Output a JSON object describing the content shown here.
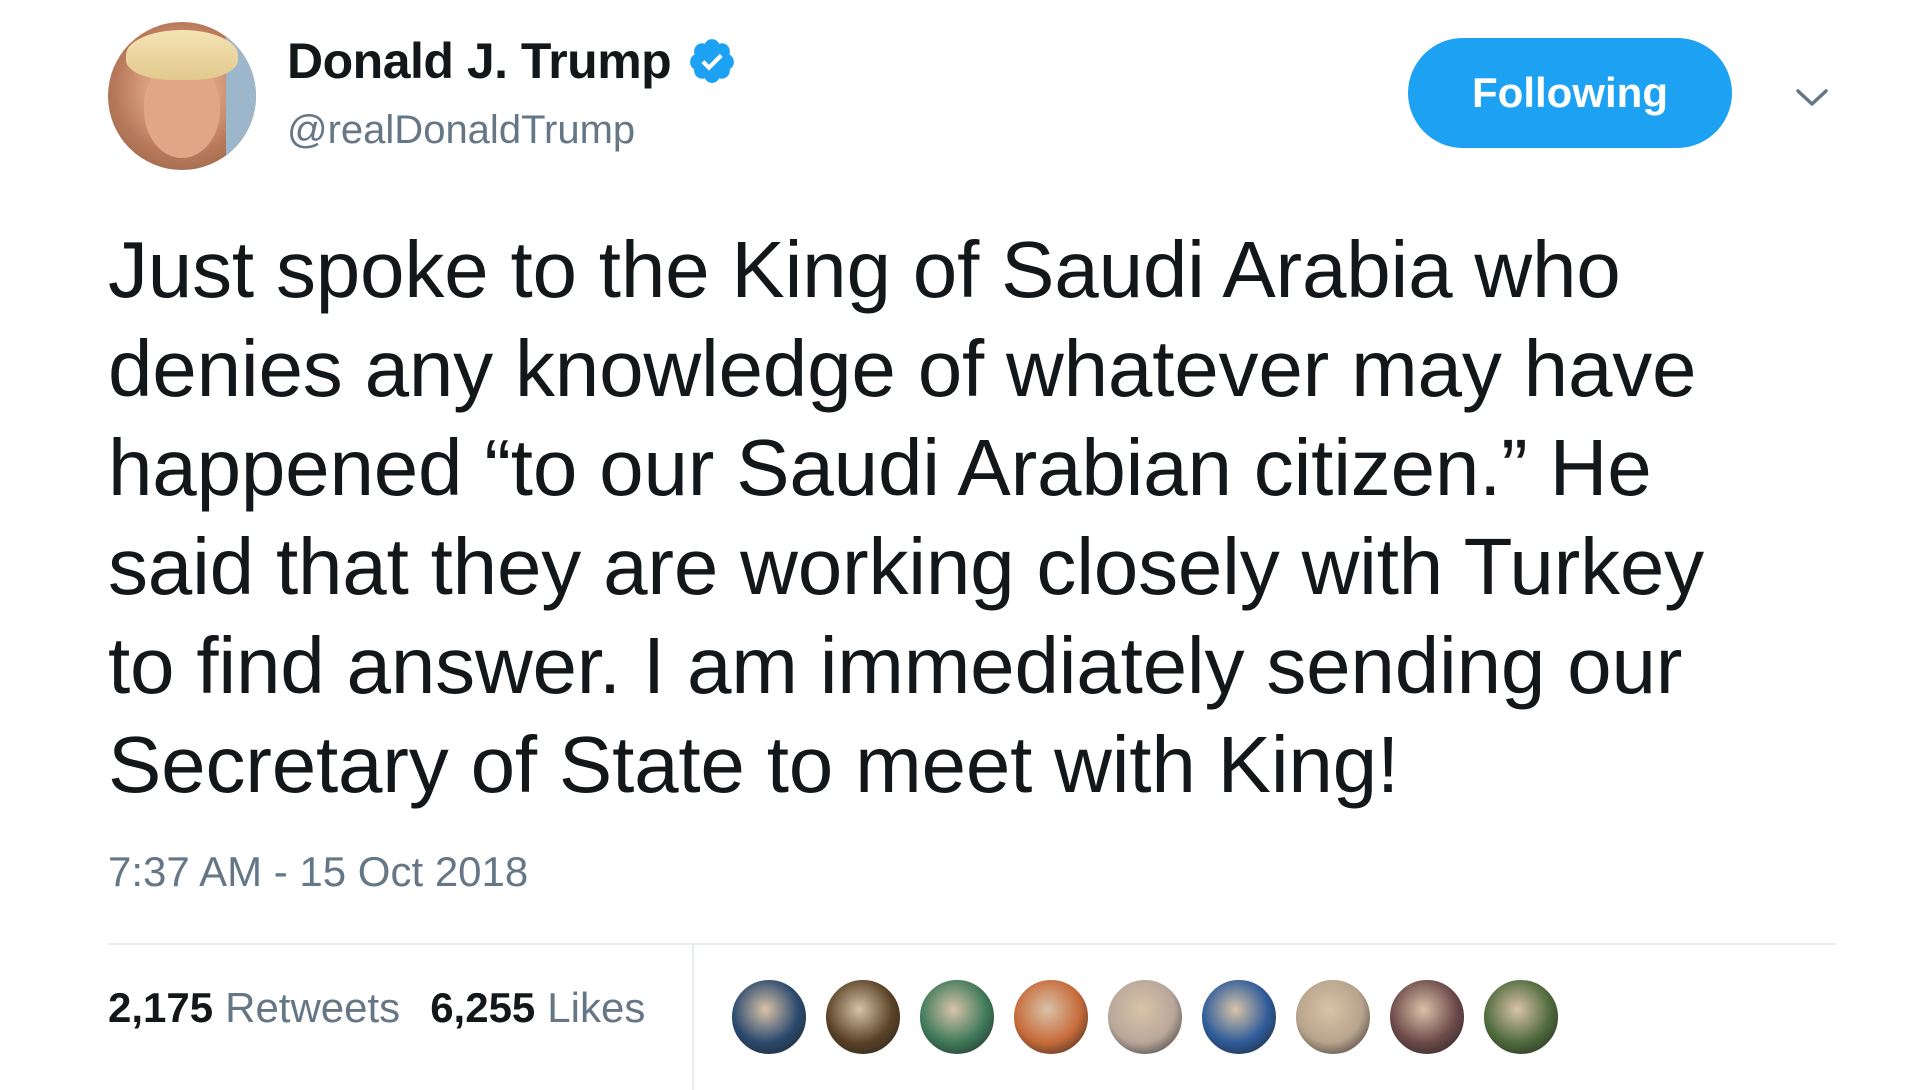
{
  "user": {
    "display_name": "Donald J. Trump",
    "handle": "@realDonaldTrump",
    "verified": true
  },
  "follow_button": {
    "label": "Following",
    "color": "#1da1f2"
  },
  "tweet": {
    "lines": [
      "Just spoke to the King of Saudi Arabia who",
      "denies any knowledge of whatever may have",
      "happened “to our Saudi Arabian citizen.” He",
      "said that they are working closely with Turkey",
      "to find answer. I am immediately sending our",
      "Secretary of State to meet with King!"
    ],
    "timestamp": "7:37 AM - 15 Oct 2018"
  },
  "stats": {
    "retweets_count": "2,175",
    "retweets_label": "Retweets",
    "likes_count": "6,255",
    "likes_label": "Likes"
  },
  "likers": [
    {
      "icon": "avatar",
      "color": "#2b4a6e"
    },
    {
      "icon": "avatar",
      "color": "#5a4326"
    },
    {
      "icon": "avatar",
      "color": "#3f7a5a"
    },
    {
      "icon": "avatar",
      "color": "#c76b3a"
    },
    {
      "icon": "avatar",
      "color": "#b9a79a"
    },
    {
      "icon": "avatar",
      "color": "#2e5c9a"
    },
    {
      "icon": "avatar",
      "color": "#b8a38c"
    },
    {
      "icon": "avatar",
      "color": "#6d4a4a"
    },
    {
      "icon": "avatar",
      "color": "#4f6b3d"
    }
  ],
  "colors": {
    "text": "#14171a",
    "muted": "#657786",
    "accent": "#1da1f2",
    "border": "#e6ecf0"
  }
}
